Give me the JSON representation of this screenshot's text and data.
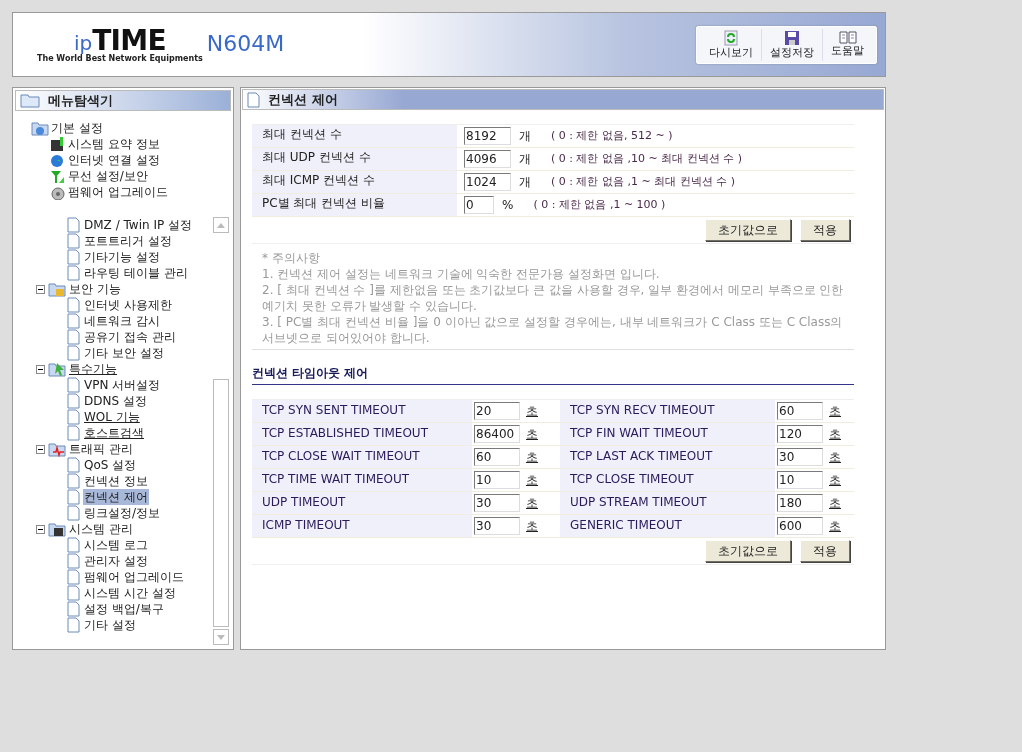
{
  "header": {
    "logo_prefix": "ip",
    "logo_main": "TIME",
    "model": "N604M",
    "tagline": "The World Best Network Equipments",
    "buttons": [
      {
        "label": "다시보기"
      },
      {
        "label": "설정저장"
      },
      {
        "label": "도움말"
      }
    ]
  },
  "sidebar": {
    "title": "메뉴탐색기",
    "pinned": {
      "label": "기본 설정",
      "children": [
        {
          "label": "시스템 요약 정보",
          "underlined": false,
          "selected": false
        },
        {
          "label": "인터넷 연결 설정",
          "underlined": false,
          "selected": false
        },
        {
          "label": "무선 설정/보안",
          "underlined": false,
          "selected": false
        },
        {
          "label": "펌웨어 업그레이드",
          "underlined": false,
          "selected": false
        }
      ]
    },
    "scroll_leaves": [
      {
        "label": "DMZ / Twin IP 설정",
        "underlined": false,
        "selected": false
      },
      {
        "label": "포트트리거 설정",
        "underlined": false,
        "selected": false
      },
      {
        "label": "기타기능 설정",
        "underlined": false,
        "selected": false
      },
      {
        "label": "라우팅 테이블 관리",
        "underlined": false,
        "selected": false
      }
    ],
    "groups": [
      {
        "label": "보안 기능",
        "expanded": true,
        "underlined": false,
        "children": [
          {
            "label": "인터넷 사용제한",
            "underlined": false,
            "selected": false
          },
          {
            "label": "네트워크 감시",
            "underlined": false,
            "selected": false
          },
          {
            "label": "공유기 접속 관리",
            "underlined": false,
            "selected": false
          },
          {
            "label": "기타 보안 설정",
            "underlined": false,
            "selected": false
          }
        ]
      },
      {
        "label": "특수기능",
        "expanded": true,
        "underlined": true,
        "children": [
          {
            "label": "VPN 서버설정",
            "underlined": false,
            "selected": false
          },
          {
            "label": "DDNS 설정",
            "underlined": false,
            "selected": false
          },
          {
            "label": "WOL 기능",
            "underlined": true,
            "selected": false
          },
          {
            "label": "호스트검색",
            "underlined": true,
            "selected": false
          }
        ]
      },
      {
        "label": "트래픽 관리",
        "expanded": true,
        "underlined": false,
        "children": [
          {
            "label": "QoS 설정",
            "underlined": false,
            "selected": false
          },
          {
            "label": "컨넥션 정보",
            "underlined": false,
            "selected": false
          },
          {
            "label": "컨넥션 제어",
            "underlined": false,
            "selected": true
          },
          {
            "label": "링크설정/정보",
            "underlined": false,
            "selected": false
          }
        ]
      },
      {
        "label": "시스템 관리",
        "expanded": true,
        "underlined": false,
        "children": [
          {
            "label": "시스템 로그",
            "underlined": false,
            "selected": false
          },
          {
            "label": "관리자 설정",
            "underlined": false,
            "selected": false
          },
          {
            "label": "펌웨어 업그레이드",
            "underlined": false,
            "selected": false
          },
          {
            "label": "시스템 시간 설정",
            "underlined": false,
            "selected": false
          },
          {
            "label": "설정 백업/복구",
            "underlined": false,
            "selected": false
          },
          {
            "label": "기타 설정",
            "underlined": false,
            "selected": false
          }
        ]
      }
    ]
  },
  "main": {
    "title": "컨넥션 제어",
    "limits": [
      {
        "label": "최대 컨넥션 수",
        "value": "8192",
        "unit": "개",
        "hint": "( 0 : 제한 없음, 512 ~ )"
      },
      {
        "label": "최대 UDP 컨넥션 수",
        "value": "4096",
        "unit": "개",
        "hint": "( 0 : 제한 없음 ,10 ~ 최대 컨넥션 수 )"
      },
      {
        "label": "최대 ICMP 컨넥션 수",
        "value": "1024",
        "unit": "개",
        "hint": "( 0 : 제한 없음 ,1 ~ 최대 컨넥션 수 )"
      },
      {
        "label": "PC별 최대 컨넥션 비율",
        "value": "0",
        "unit": "%",
        "hint": "( 0 : 제한 없음 ,1 ~ 100 )"
      }
    ],
    "limit_buttons": [
      "초기값으로",
      "적용"
    ],
    "notes": [
      "* 주의사항",
      "1. 컨넥션 제어 설정는 네트워크 기술에 익숙한 전문가용 설정화면 입니다.",
      "2. [ 최대 컨넥션 수 ]를 제한없음 또는 초기값보다 큰 값을 사용할 경우, 일부 환경에서 메모리 부족으로 인한 예기치 못한 오류가 발생할 수 있습니다.",
      "3. [ PC별 최대 컨넥션 비율 ]을 0 이아닌 값으로 설정할 경우에는, 내부 네트워크가 C Class 또는 C Class의 서브넷으로 되어있어야 합니다."
    ],
    "timeout_title": "컨넥션 타임아웃 제어",
    "timeouts": [
      [
        {
          "label": "TCP SYN SENT TIMEOUT",
          "value": "20",
          "unit": "초"
        },
        {
          "label": "TCP SYN RECV TIMEOUT",
          "value": "60",
          "unit": "초"
        }
      ],
      [
        {
          "label": "TCP ESTABLISHED TIMEOUT",
          "value": "86400",
          "unit": "초"
        },
        {
          "label": "TCP FIN WAIT TIMEOUT",
          "value": "120",
          "unit": "초"
        }
      ],
      [
        {
          "label": "TCP CLOSE WAIT TIMEOUT",
          "value": "60",
          "unit": "초"
        },
        {
          "label": "TCP LAST ACK TIMEOUT",
          "value": "30",
          "unit": "초"
        }
      ],
      [
        {
          "label": "TCP TIME WAIT TIMEOUT",
          "value": "10",
          "unit": "초"
        },
        {
          "label": "TCP CLOSE TIMEOUT",
          "value": "10",
          "unit": "초"
        }
      ],
      [
        {
          "label": "UDP TIMEOUT",
          "value": "30",
          "unit": "초"
        },
        {
          "label": "UDP STREAM TIMEOUT",
          "value": "180",
          "unit": "초"
        }
      ],
      [
        {
          "label": "ICMP TIMEOUT",
          "value": "30",
          "unit": "초"
        },
        {
          "label": "GENERIC TIMEOUT",
          "value": "600",
          "unit": "초"
        }
      ]
    ],
    "timeout_buttons": [
      "초기값으로",
      "적용"
    ]
  }
}
